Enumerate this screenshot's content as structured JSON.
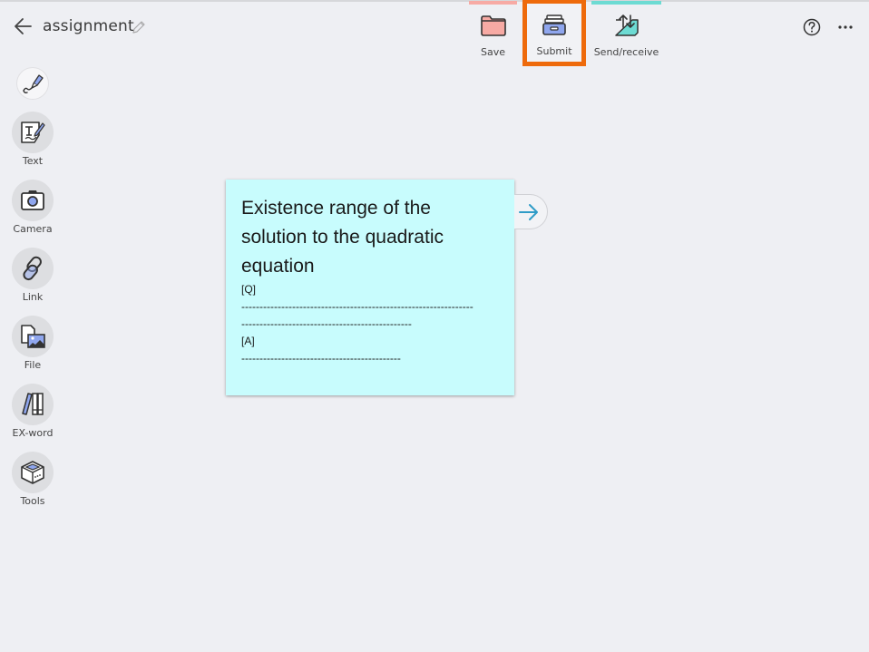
{
  "header": {
    "title": "assignment",
    "back_icon": "arrow-left-icon",
    "edit_icon": "pencil-icon"
  },
  "toolbar": {
    "save": {
      "label": "Save",
      "icon": "folder-icon",
      "accent": "#f7aaa4"
    },
    "submit": {
      "label": "Submit",
      "icon": "submit-tray-icon",
      "highlight": "#ee6a0b"
    },
    "send_receive": {
      "label": "Send/receive",
      "icon": "send-receive-icon",
      "accent": "#6ddbd3"
    },
    "help_icon": "help-icon",
    "more_icon": "more-icon"
  },
  "sidebar": {
    "items": [
      {
        "label": "",
        "icon": "pen-icon"
      },
      {
        "label": "Text",
        "icon": "text-icon"
      },
      {
        "label": "Camera",
        "icon": "camera-icon"
      },
      {
        "label": "Link",
        "icon": "link-icon"
      },
      {
        "label": "File",
        "icon": "file-icon"
      },
      {
        "label": "EX-word",
        "icon": "dictionary-icon"
      },
      {
        "label": "Tools",
        "icon": "tools-box-icon"
      }
    ]
  },
  "card": {
    "background": "#c8fcfd",
    "heading": "Existence range of the solution to the quadratic equation",
    "lines": [
      "[Q]",
      "----------------------------------------------------------------",
      "-----------------------------------------------",
      "[A]",
      "--------------------------------------------"
    ],
    "next_icon": "arrow-right-icon"
  }
}
